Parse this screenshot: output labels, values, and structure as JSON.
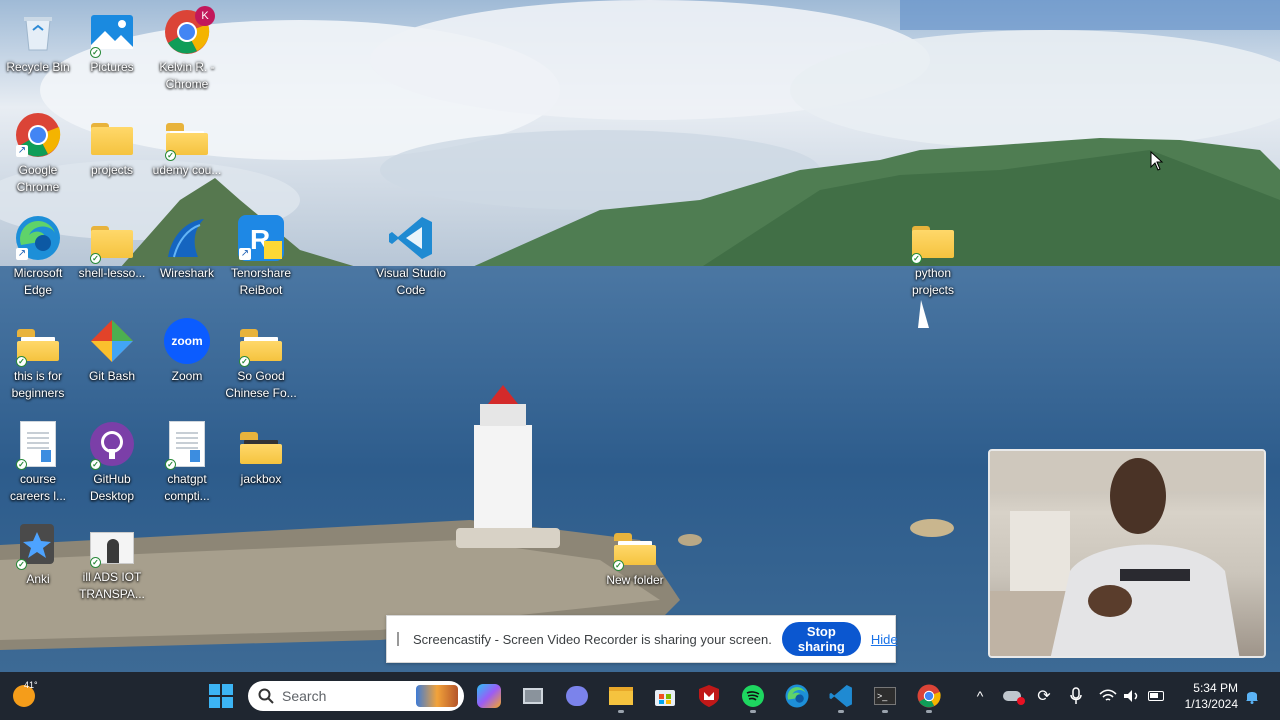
{
  "desktop": {
    "icons": [
      {
        "label": "Recycle Bin",
        "icon": "recycle-bin-icon"
      },
      {
        "label": "Pictures",
        "icon": "pictures-icon"
      },
      {
        "label": "Kelvin R. - Chrome",
        "icon": "chrome-icon",
        "badge": "K"
      },
      {
        "label": "Google Chrome",
        "icon": "chrome-icon"
      },
      {
        "label": "projects",
        "icon": "folder-icon"
      },
      {
        "label": "udemy cou...",
        "icon": "folder-icon"
      },
      {
        "label": "Microsoft Edge",
        "icon": "edge-icon"
      },
      {
        "label": "shell-lesso...",
        "icon": "folder-icon"
      },
      {
        "label": "Wireshark",
        "icon": "wireshark-icon"
      },
      {
        "label": "Tenorshare ReiBoot",
        "icon": "reiboot-icon"
      },
      {
        "label": "Visual Studio Code",
        "icon": "vscode-icon"
      },
      {
        "label": "python projects",
        "icon": "folder-icon"
      },
      {
        "label": "this is for beginners",
        "icon": "folder-icon"
      },
      {
        "label": "Git Bash",
        "icon": "git-bash-icon"
      },
      {
        "label": "Zoom",
        "icon": "zoom-icon",
        "glyph_text": "zoom"
      },
      {
        "label": "So Good Chinese Fo...",
        "icon": "folder-icon"
      },
      {
        "label": "course careers l...",
        "icon": "document-icon"
      },
      {
        "label": "GitHub Desktop",
        "icon": "github-desktop-icon"
      },
      {
        "label": "chatgpt compti...",
        "icon": "document-icon"
      },
      {
        "label": "jackbox",
        "icon": "folder-icon"
      },
      {
        "label": "Anki",
        "icon": "anki-icon"
      },
      {
        "label": "ill ADS IOT TRANSPA...",
        "icon": "image-file-icon"
      },
      {
        "label": "New folder",
        "icon": "folder-icon"
      }
    ]
  },
  "share_bar": {
    "message": "Screencastify - Screen Video Recorder is sharing your screen.",
    "stop_label": "Stop sharing",
    "hide_label": "Hide"
  },
  "taskbar": {
    "weather": "41°",
    "search_placeholder": "Search",
    "pinned": [
      "widgets-icon",
      "start-icon",
      "copilot-icon",
      "task-view-icon",
      "teams-chat-icon",
      "file-explorer-icon",
      "microsoft-store-icon",
      "mcafee-icon",
      "spotify-icon",
      "edge-icon",
      "vscode-icon",
      "terminal-icon",
      "chrome-icon"
    ],
    "tray": [
      "chevron-up-icon",
      "onedrive-icon",
      "sync-icon",
      "microphone-icon",
      "wifi-icon",
      "volume-icon",
      "battery-icon",
      "notification-bell-icon"
    ],
    "time": "5:34 PM",
    "date": "1/13/2024"
  }
}
